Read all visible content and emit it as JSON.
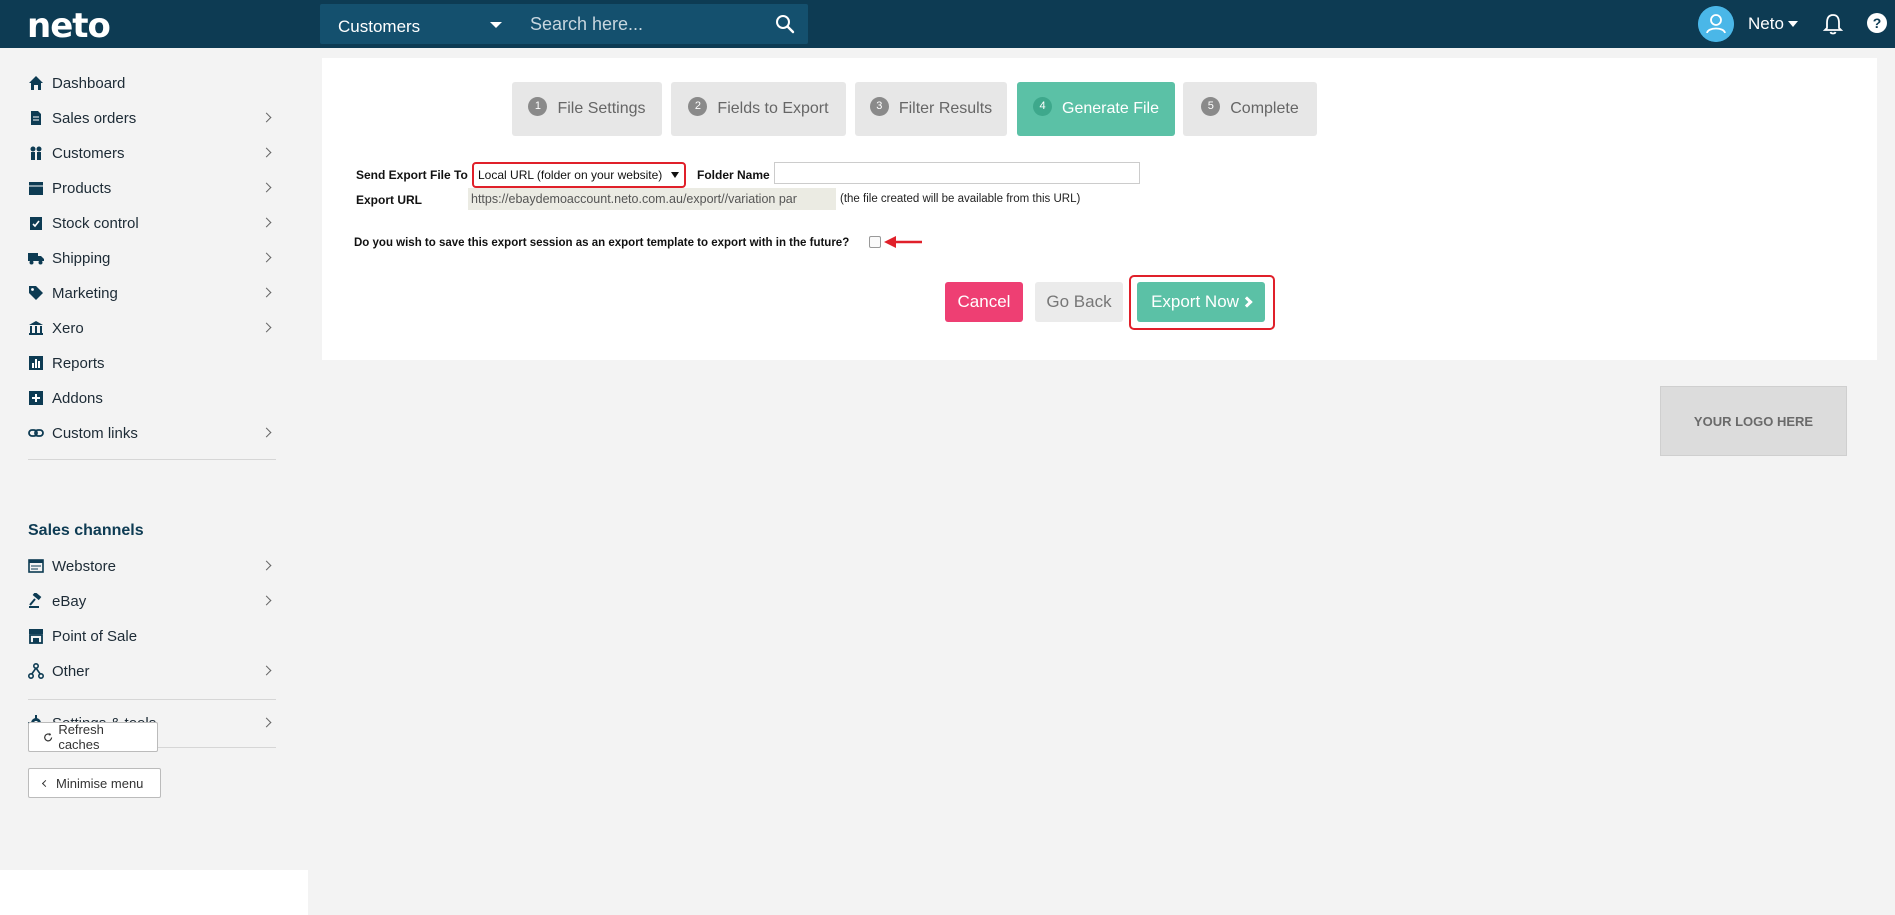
{
  "app": {
    "logo_text": "neto"
  },
  "search": {
    "scope": "Customers",
    "placeholder": "Search here..."
  },
  "user": {
    "name": "Neto"
  },
  "sidebar": {
    "items": [
      {
        "label": "Dashboard",
        "icon": "home-icon",
        "has_submenu": false
      },
      {
        "label": "Sales orders",
        "icon": "document-icon",
        "has_submenu": true
      },
      {
        "label": "Customers",
        "icon": "people-icon",
        "has_submenu": true
      },
      {
        "label": "Products",
        "icon": "box-icon",
        "has_submenu": true
      },
      {
        "label": "Stock control",
        "icon": "clipboard-icon",
        "has_submenu": true
      },
      {
        "label": "Shipping",
        "icon": "truck-icon",
        "has_submenu": true
      },
      {
        "label": "Marketing",
        "icon": "tag-icon",
        "has_submenu": true
      },
      {
        "label": "Xero",
        "icon": "bank-icon",
        "has_submenu": true
      },
      {
        "label": "Reports",
        "icon": "bar-chart-icon",
        "has_submenu": false
      },
      {
        "label": "Addons",
        "icon": "plus-square-icon",
        "has_submenu": false
      },
      {
        "label": "Custom links",
        "icon": "link-icon",
        "has_submenu": true
      }
    ],
    "sales_channels_title": "Sales channels",
    "channels": [
      {
        "label": "Webstore",
        "icon": "browser-icon",
        "has_submenu": true
      },
      {
        "label": "eBay",
        "icon": "gavel-icon",
        "has_submenu": true
      },
      {
        "label": "Point of Sale",
        "icon": "store-icon",
        "has_submenu": false
      },
      {
        "label": "Other",
        "icon": "network-icon",
        "has_submenu": true
      }
    ],
    "settings": {
      "label": "Settings & tools",
      "icon": "gear-icon"
    },
    "refresh_label": "Refresh caches",
    "minimise_label": "Minimise menu"
  },
  "wizard": {
    "steps": [
      {
        "num": "1",
        "label": "File Settings",
        "active": false
      },
      {
        "num": "2",
        "label": "Fields to Export",
        "active": false
      },
      {
        "num": "3",
        "label": "Filter Results",
        "active": false
      },
      {
        "num": "4",
        "label": "Generate File",
        "active": true
      },
      {
        "num": "5",
        "label": "Complete",
        "active": false
      }
    ]
  },
  "form": {
    "send_to_label": "Send Export File To",
    "send_to_value": "Local URL (folder on your website)",
    "folder_label": "Folder Name",
    "folder_value": "",
    "export_url_label": "Export URL",
    "export_url_value": "https://ebaydemoaccount.neto.com.au/export//variation par",
    "export_url_note": "(the file created will be available from this URL)",
    "save_template_question": "Do you wish to save this export session as an export template to export with in the future?",
    "save_template_checked": false
  },
  "actions": {
    "cancel": "Cancel",
    "go_back": "Go Back",
    "export_now": "Export Now"
  },
  "logo_placeholder": "YOUR LOGO HERE",
  "colors": {
    "topbar": "#0d3b53",
    "accent_green": "#5bc1a6",
    "cancel_pink": "#ee3f73",
    "highlight_red": "#e0202a"
  }
}
